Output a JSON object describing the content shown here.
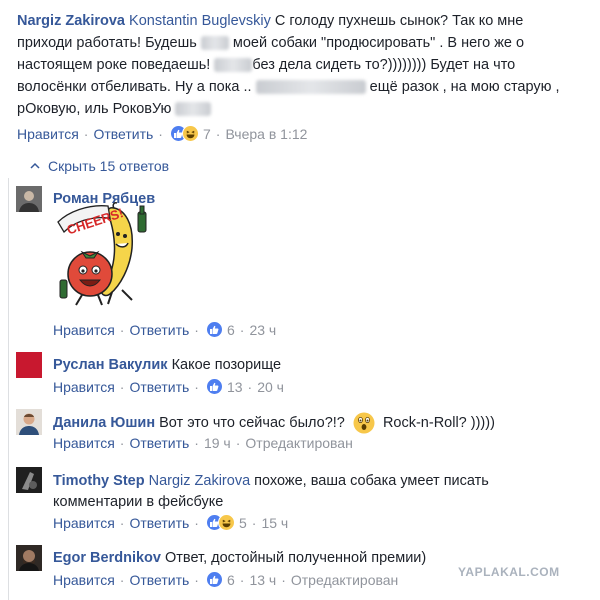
{
  "top_comment": {
    "author": "Nargiz Zakirova",
    "mention": "Konstantin Buglevskiy",
    "text_1": "С голоду пухнешь сынок? Так ко мне",
    "text_2": "приходи работать! Будешь",
    "text_3": "моей собаки \"продюсировать\" . В него же о",
    "text_4": "настоящем роке поведаешь!",
    "text_5": "без дела сидеть то?)))))))) Будет на что",
    "text_6": "волосёнки отбеливать. Ну а пока ..",
    "text_7": "ещё разок , на мою старую ,",
    "text_8": "рОковую, иль РоковУю",
    "like_label": "Нравится",
    "reply_label": "Ответить",
    "reactions_count": "7",
    "time": "Вчера в 1:12"
  },
  "hide_replies_label": "Скрыть 15 ответов",
  "replies": [
    {
      "author": "Роман Рябцев",
      "text": "",
      "sticker_text": "CHEERS!",
      "like_label": "Нравится",
      "reply_label": "Ответить",
      "reactions_count": "6",
      "time": "23 ч"
    },
    {
      "author": "Руслан Вакулик",
      "text": "Какое позорище",
      "like_label": "Нравится",
      "reply_label": "Ответить",
      "reactions_count": "13",
      "time": "20 ч"
    },
    {
      "author": "Данила Юшин",
      "text": "Вот это что сейчас было?!?",
      "text_after": "Rock-n-Roll? )))))",
      "like_label": "Нравится",
      "reply_label": "Ответить",
      "time": "19 ч",
      "edited": "Отредактирован"
    },
    {
      "author": "Timothy Step",
      "mention": "Nargiz Zakirova",
      "text": "похоже, ваша собака умеет писать",
      "text_2": "комментарии в фейсбуке",
      "like_label": "Нравится",
      "reply_label": "Ответить",
      "reactions_count": "5",
      "time": "15 ч"
    },
    {
      "author": "Egor Berdnikov",
      "text": "Ответ, достойный полученной премии)",
      "like_label": "Нравится",
      "reply_label": "Ответить",
      "reactions_count": "6",
      "time": "13 ч",
      "edited": "Отредактирован"
    }
  ],
  "watermark": "YAPLAKAL.COM",
  "colors": {
    "link": "#365899",
    "muted": "#90949c",
    "text": "#1d2129",
    "like_blue": "#4e7ef0",
    "haha_yellow": "#f7c74a"
  }
}
